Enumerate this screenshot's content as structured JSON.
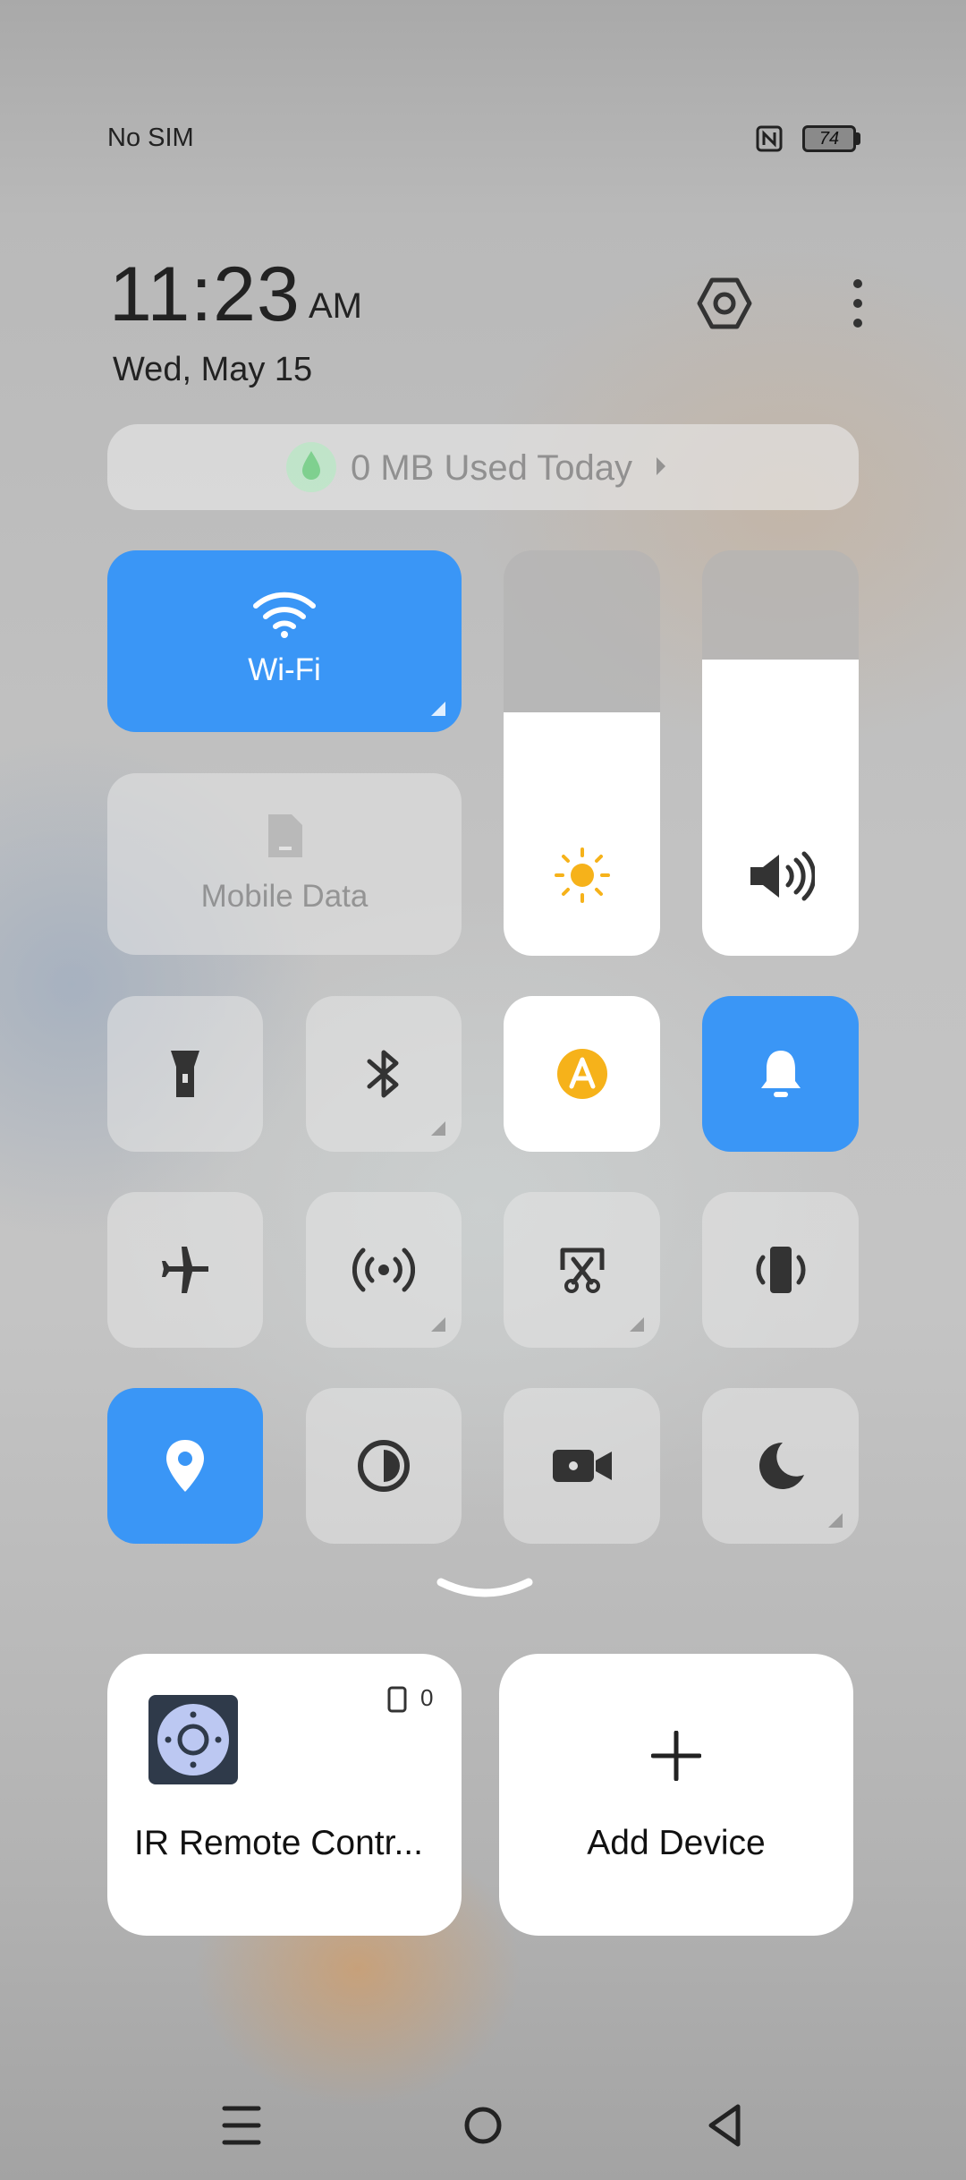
{
  "status_bar": {
    "carrier": "No SIM",
    "battery_level": "74"
  },
  "clock": {
    "time": "11:23",
    "ampm": "AM",
    "date": "Wed, May 15"
  },
  "header_icons": [
    "settings-hexagon-icon",
    "more-vertical-icon"
  ],
  "data_usage": {
    "text": "0 MB Used Today"
  },
  "tiles": {
    "wifi": {
      "label": "Wi-Fi",
      "active": true
    },
    "mobile_data": {
      "label": "Mobile Data",
      "active": false
    },
    "row1": [
      "flashlight",
      "bluetooth",
      "auto-brightness",
      "ring"
    ],
    "row2": [
      "airplane-mode",
      "hotspot",
      "screenshot",
      "vibrate"
    ],
    "row3": [
      "location",
      "dark-mode",
      "screen-recorder",
      "do-not-disturb"
    ]
  },
  "sliders": {
    "brightness_level": 0.6,
    "volume_level": 0.73
  },
  "devices": {
    "ir_remote": {
      "label": "IR Remote Contr...",
      "count": "0"
    },
    "add_device": {
      "label": "Add Device"
    }
  },
  "colors": {
    "accent": "#3a96f6",
    "sun": "#f6b21a",
    "tile_inactive": "rgba(230,230,230,0.55)"
  }
}
